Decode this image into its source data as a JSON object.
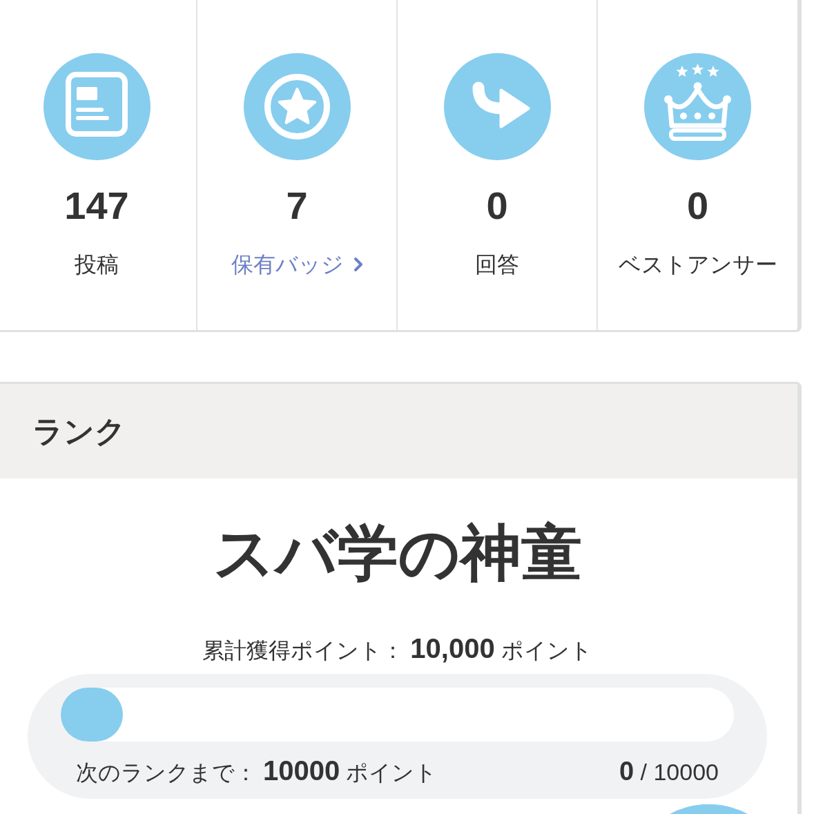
{
  "stats": [
    {
      "kind": "posts",
      "value": "147",
      "label": "投稿",
      "link": false
    },
    {
      "kind": "badges",
      "value": "7",
      "label": "保有バッジ",
      "link": true
    },
    {
      "kind": "answers",
      "value": "0",
      "label": "回答",
      "link": false
    },
    {
      "kind": "best_answers",
      "value": "0",
      "label": "ベストアンサー",
      "link": false
    }
  ],
  "rank": {
    "header": "ランク",
    "title": "スバ学の神童",
    "total": "累計獲得ポイント： **10,000** ポイント",
    "progress": {
      "level": 0,
      "next": "次のランクまで： **10000** ポイント",
      "count": "**0** / 10000"
    }
  }
}
